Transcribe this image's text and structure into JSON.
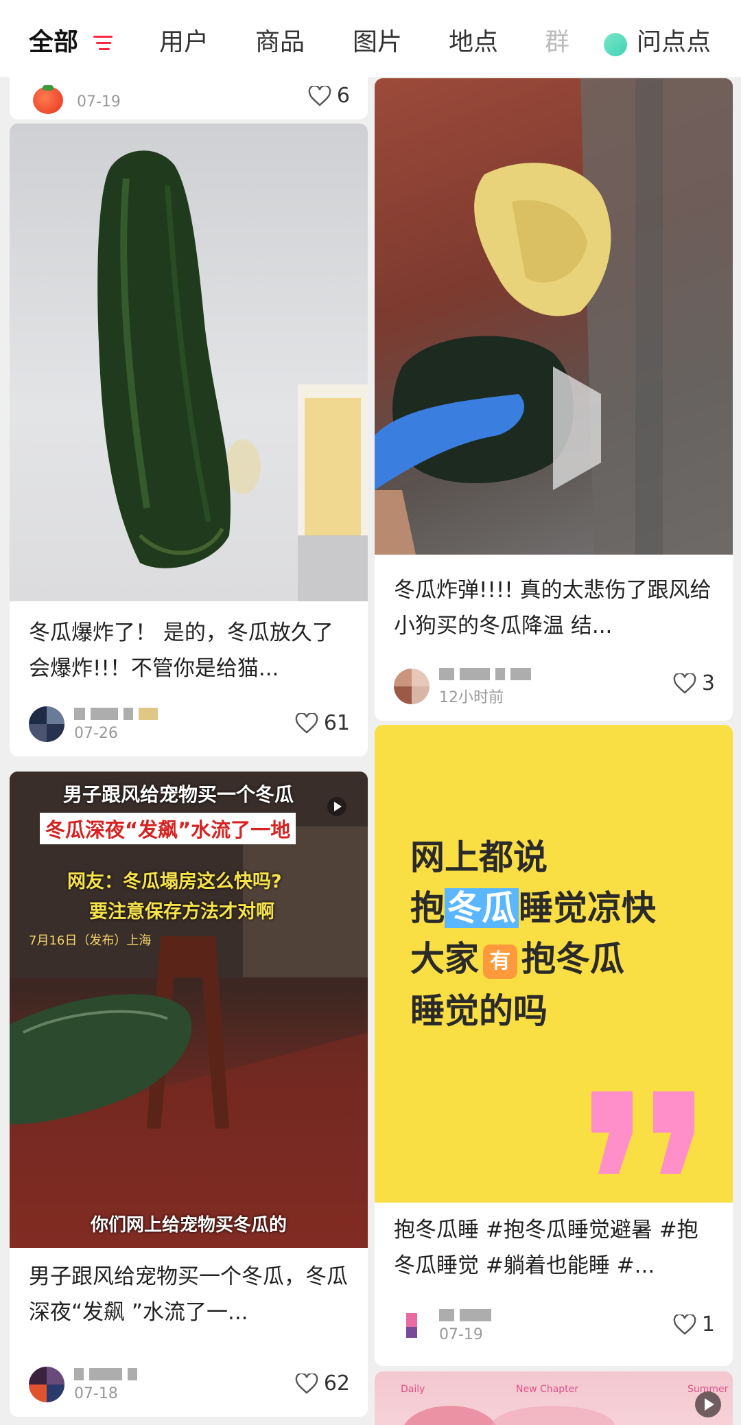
{
  "tabs": {
    "all": "全部",
    "users": "用户",
    "products": "商品",
    "images": "图片",
    "places": "地点",
    "groups": "群",
    "ask": "问点点"
  },
  "accent_color": "#ff2442",
  "feed": {
    "left": [
      {
        "author_date": "07-19",
        "likes": "6"
      },
      {
        "title": "冬瓜爆炸了！ 是的，冬瓜放久了会爆炸!!！不管你是给猫...",
        "author_date": "07-26",
        "likes": "61",
        "image_icon": "cucumber-photo"
      },
      {
        "title": "男子跟风给宠物买一个冬瓜，冬瓜深夜“发飙 ”水流了一...",
        "overlay_line1": "男子跟风给宠物买一个冬瓜",
        "overlay_line2": "冬瓜深夜“发飙”水流了一地",
        "overlay_line3": "网友：冬瓜塌房这么快吗?",
        "overlay_line4": "要注意保存方法才对啊",
        "overlay_source": "7月16日（发布）上海",
        "overlay_caption": "你们网上给宠物买冬瓜的",
        "author_date": "07-18",
        "likes": "62"
      }
    ],
    "right": [
      {
        "title": "冬瓜炸弹!!!! 真的太悲伤了跟风给小狗买的冬瓜降温 结...",
        "author_date": "12小时前",
        "likes": "3"
      },
      {
        "yellow_line1": "网上都说",
        "yellow_line2_a": "抱",
        "yellow_line2_hl": "冬瓜",
        "yellow_line2_b": "睡觉凉快",
        "yellow_line3_a": "大家",
        "yellow_line3_box": "有",
        "yellow_line3_b": "抱冬瓜",
        "yellow_line4": "睡觉的吗",
        "title": "抱冬瓜睡 #抱冬瓜睡觉避暑 #抱冬瓜睡觉 #躺着也能睡 #...",
        "author_date": "07-19",
        "likes": "1"
      },
      {
        "label_left": "Daily",
        "label_mid": "New Chapter",
        "label_right": "Summer"
      }
    ]
  }
}
